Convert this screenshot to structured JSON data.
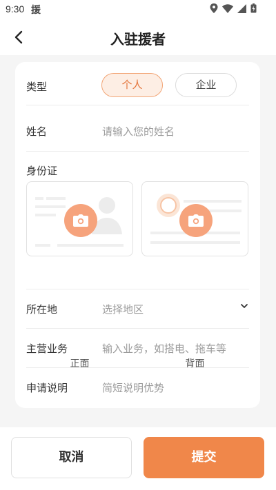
{
  "status": {
    "time": "9:30",
    "app_glyph": "援"
  },
  "header": {
    "title": "入驻援者",
    "back_icon": "chevron-left-icon"
  },
  "form": {
    "type": {
      "label": "类型",
      "options": [
        "个人",
        "企业"
      ],
      "selected": "个人"
    },
    "name": {
      "label": "姓名",
      "placeholder": "请输入您的姓名"
    },
    "id_card": {
      "label": "身份证",
      "front_caption": "正面",
      "back_caption": "背面"
    },
    "location": {
      "label": "所在地",
      "placeholder": "选择地区"
    },
    "business": {
      "label": "主营业务",
      "placeholder": "输入业务，如搭电、拖车等"
    },
    "description": {
      "label": "申请说明",
      "placeholder": "简短说明优势"
    }
  },
  "footer": {
    "cancel_label": "取消",
    "submit_label": "提交"
  },
  "colors": {
    "accent": "#f0874a",
    "accent_light": "#fdeee4",
    "camera": "#f6a37c"
  }
}
